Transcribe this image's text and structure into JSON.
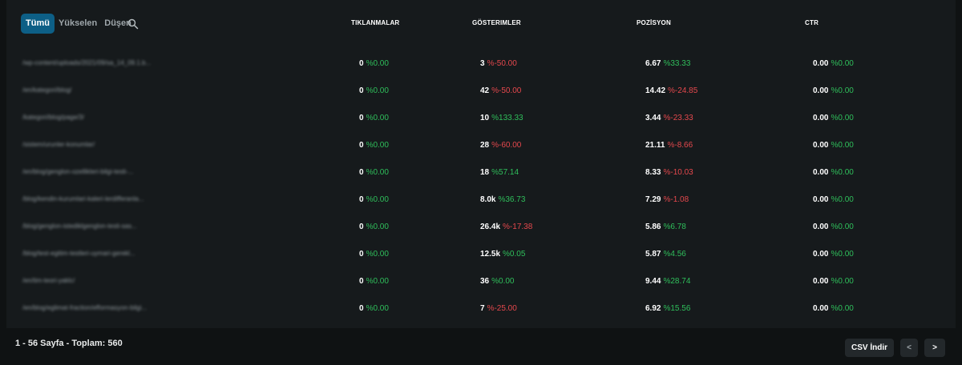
{
  "filters": {
    "all": "Tümü",
    "rising": "Yükselen",
    "falling": "Düşen"
  },
  "headers": {
    "clicks": "TIKLANMALAR",
    "impressions": "GÖSTERIMLER",
    "position": "POZİSYON",
    "ctr": "CTR"
  },
  "rows": [
    {
      "url": "/wp-content/uploads/2021/09/sa_14_09.1.b...",
      "clicks": {
        "value": "0",
        "change": "%0.00",
        "trend": "up"
      },
      "impressions": {
        "value": "3",
        "change": "%-50.00",
        "trend": "down"
      },
      "position": {
        "value": "6.67",
        "change": "%33.33",
        "trend": "up"
      },
      "ctr": {
        "value": "0.00",
        "change": "%0.00",
        "trend": "up"
      }
    },
    {
      "url": "/en/kategori/blog/",
      "clicks": {
        "value": "0",
        "change": "%0.00",
        "trend": "up"
      },
      "impressions": {
        "value": "42",
        "change": "%-50.00",
        "trend": "down"
      },
      "position": {
        "value": "14.42",
        "change": "%-24.85",
        "trend": "down"
      },
      "ctr": {
        "value": "0.00",
        "change": "%0.00",
        "trend": "up"
      }
    },
    {
      "url": "/kategori/blog/page/3/",
      "clicks": {
        "value": "0",
        "change": "%0.00",
        "trend": "up"
      },
      "impressions": {
        "value": "10",
        "change": "%133.33",
        "trend": "up"
      },
      "position": {
        "value": "3.44",
        "change": "%-23.33",
        "trend": "down"
      },
      "ctr": {
        "value": "0.00",
        "change": "%0.00",
        "trend": "up"
      }
    },
    {
      "url": "/sistem/urunler-konumlar/",
      "clicks": {
        "value": "0",
        "change": "%0.00",
        "trend": "up"
      },
      "impressions": {
        "value": "28",
        "change": "%-60.00",
        "trend": "down"
      },
      "position": {
        "value": "21.11",
        "change": "%-8.66",
        "trend": "down"
      },
      "ctr": {
        "value": "0.00",
        "change": "%0.00",
        "trend": "up"
      }
    },
    {
      "url": "/en/blog/genglon-ozellikleri-bilgi-testi-...",
      "clicks": {
        "value": "0",
        "change": "%0.00",
        "trend": "up"
      },
      "impressions": {
        "value": "18",
        "change": "%57.14",
        "trend": "up"
      },
      "position": {
        "value": "8.33",
        "change": "%-10.03",
        "trend": "down"
      },
      "ctr": {
        "value": "0.00",
        "change": "%0.00",
        "trend": "up"
      }
    },
    {
      "url": "/blog/kendin-kurumlari-kaleri-lerdifferanla...",
      "clicks": {
        "value": "0",
        "change": "%0.00",
        "trend": "up"
      },
      "impressions": {
        "value": "8.0k",
        "change": "%36.73",
        "trend": "up"
      },
      "position": {
        "value": "7.29",
        "change": "%-1.08",
        "trend": "down"
      },
      "ctr": {
        "value": "0.00",
        "change": "%0.00",
        "trend": "up"
      }
    },
    {
      "url": "/blog/genglon-istediklgenglon-testi-sas...",
      "clicks": {
        "value": "0",
        "change": "%0.00",
        "trend": "up"
      },
      "impressions": {
        "value": "26.4k",
        "change": "%-17.38",
        "trend": "down"
      },
      "position": {
        "value": "5.86",
        "change": "%6.78",
        "trend": "up"
      },
      "ctr": {
        "value": "0.00",
        "change": "%0.00",
        "trend": "up"
      }
    },
    {
      "url": "/blog/test-egitim-testleri-uymari-gerekl...",
      "clicks": {
        "value": "0",
        "change": "%0.00",
        "trend": "up"
      },
      "impressions": {
        "value": "12.5k",
        "change": "%0.05",
        "trend": "up"
      },
      "position": {
        "value": "5.87",
        "change": "%4.56",
        "trend": "up"
      },
      "ctr": {
        "value": "0.00",
        "change": "%0.00",
        "trend": "up"
      }
    },
    {
      "url": "/en/tim-teori-yaklc/",
      "clicks": {
        "value": "0",
        "change": "%0.00",
        "trend": "up"
      },
      "impressions": {
        "value": "36",
        "change": "%0.00",
        "trend": "up"
      },
      "position": {
        "value": "9.44",
        "change": "%28.74",
        "trend": "up"
      },
      "ctr": {
        "value": "0.00",
        "change": "%0.00",
        "trend": "up"
      }
    },
    {
      "url": "/en/blog/eglimat-fraction/efformasyon-bilgi...",
      "clicks": {
        "value": "0",
        "change": "%0.00",
        "trend": "up"
      },
      "impressions": {
        "value": "7",
        "change": "%-25.00",
        "trend": "down"
      },
      "position": {
        "value": "6.92",
        "change": "%15.56",
        "trend": "up"
      },
      "ctr": {
        "value": "0.00",
        "change": "%0.00",
        "trend": "up"
      }
    }
  ],
  "footer": {
    "pagination_text": "1 - 56 Sayfa - Toplam: 560",
    "csv_label": "CSV İndir",
    "prev_label": "<",
    "next_label": ">"
  },
  "colors": {
    "accent": "#0d5f86",
    "positive": "#2fbf5b",
    "negative": "#e5484d",
    "background": "#161a1c"
  }
}
